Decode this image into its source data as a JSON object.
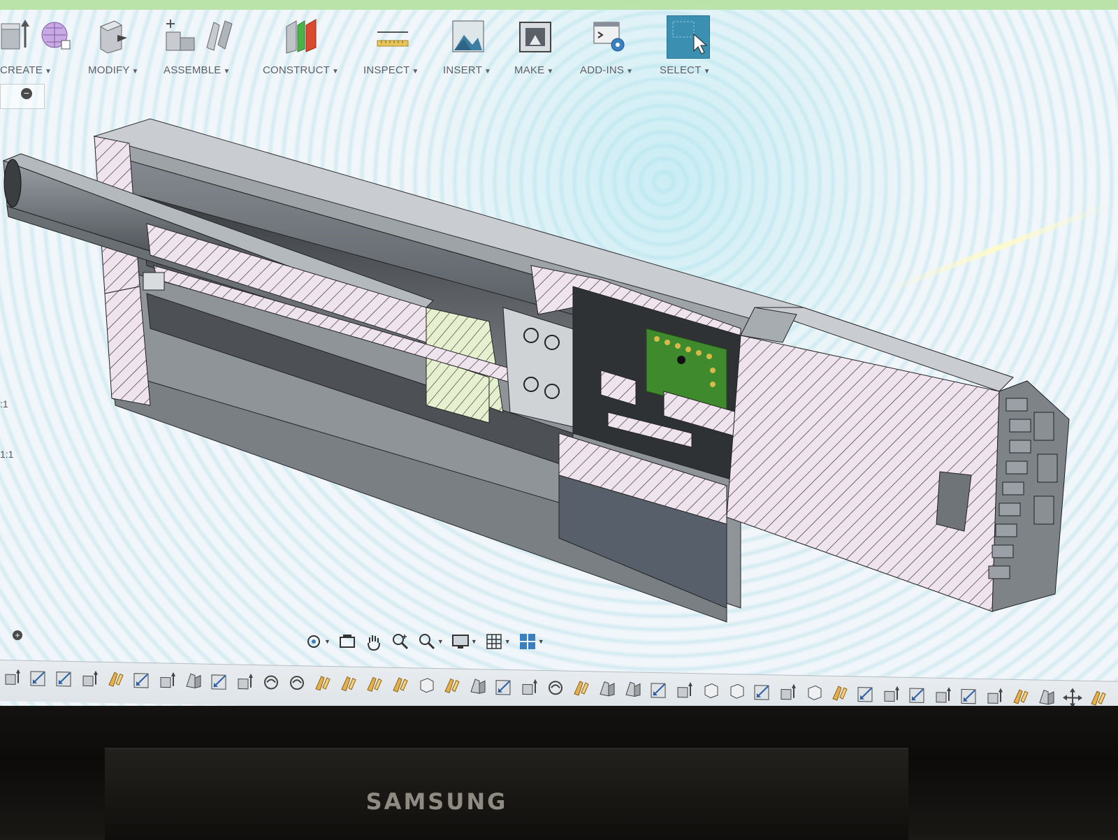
{
  "toolbar": {
    "groups": [
      {
        "id": "create",
        "label": "CREATE",
        "icons": [
          "extrude-icon",
          "form-icon"
        ]
      },
      {
        "id": "modify",
        "label": "MODIFY",
        "icons": [
          "press-pull-icon"
        ]
      },
      {
        "id": "assemble",
        "label": "ASSEMBLE",
        "icons": [
          "new-component-icon",
          "joint-icon"
        ]
      },
      {
        "id": "construct",
        "label": "CONSTRUCT",
        "icons": [
          "offset-plane-icon"
        ]
      },
      {
        "id": "inspect",
        "label": "INSPECT",
        "icons": [
          "measure-icon"
        ]
      },
      {
        "id": "insert",
        "label": "INSERT",
        "icons": [
          "insert-image-icon"
        ]
      },
      {
        "id": "make",
        "label": "MAKE",
        "icons": [
          "3d-print-icon"
        ]
      },
      {
        "id": "addins",
        "label": "ADD-INS",
        "icons": [
          "scripts-icon"
        ]
      },
      {
        "id": "select",
        "label": "SELECT",
        "icons": [
          "select-cursor-icon"
        ]
      }
    ]
  },
  "side": {
    "scale_a": ":1",
    "scale_b": "1:1"
  },
  "navbar": {
    "items": [
      "orbit-icon",
      "look-at-icon",
      "pan-icon",
      "zoom-icon",
      "fit-icon",
      "display-settings-icon",
      "grid-icon",
      "viewports-icon"
    ]
  },
  "timeline": {
    "items": [
      "extrude",
      "sketch",
      "sketch",
      "extrude",
      "joint",
      "sketch",
      "extrude",
      "fillet",
      "sketch",
      "extrude",
      "revolve",
      "revolve",
      "joint",
      "joint",
      "joint",
      "joint",
      "box",
      "joint",
      "fillet",
      "sketch",
      "extrude",
      "revolve",
      "joint",
      "fillet",
      "fillet",
      "sketch",
      "extrude",
      "box",
      "box",
      "sketch",
      "extrude",
      "box",
      "joint",
      "sketch",
      "extrude",
      "sketch",
      "extrude",
      "sketch",
      "extrude",
      "joint",
      "fillet",
      "move",
      "joint"
    ]
  },
  "monitor": {
    "brand": "SAMSUNG"
  },
  "colors": {
    "select_accent": "#3b8fb0",
    "hatch": "#2b2b2b",
    "pcb": "#3f8a2c"
  }
}
